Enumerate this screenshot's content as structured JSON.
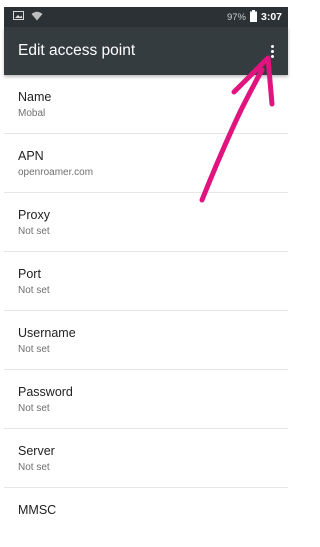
{
  "status_bar": {
    "battery_percent": "97%",
    "time": "3:07",
    "icons": [
      "image-notification-icon",
      "wifi-icon",
      "battery-icon"
    ]
  },
  "app_bar": {
    "title": "Edit access point",
    "menu_icon": "more-vert-icon"
  },
  "preferences": [
    {
      "title": "Name",
      "summary": "Mobal"
    },
    {
      "title": "APN",
      "summary": "openroamer.com"
    },
    {
      "title": "Proxy",
      "summary": "Not set"
    },
    {
      "title": "Port",
      "summary": "Not set"
    },
    {
      "title": "Username",
      "summary": "Not set"
    },
    {
      "title": "Password",
      "summary": "Not set"
    },
    {
      "title": "Server",
      "summary": "Not set"
    },
    {
      "title": "MMSC",
      "summary": ""
    }
  ],
  "colors": {
    "toolbar": "#353c40",
    "status_bar": "#2b3134",
    "annotation_arrow": "#e0137f"
  }
}
